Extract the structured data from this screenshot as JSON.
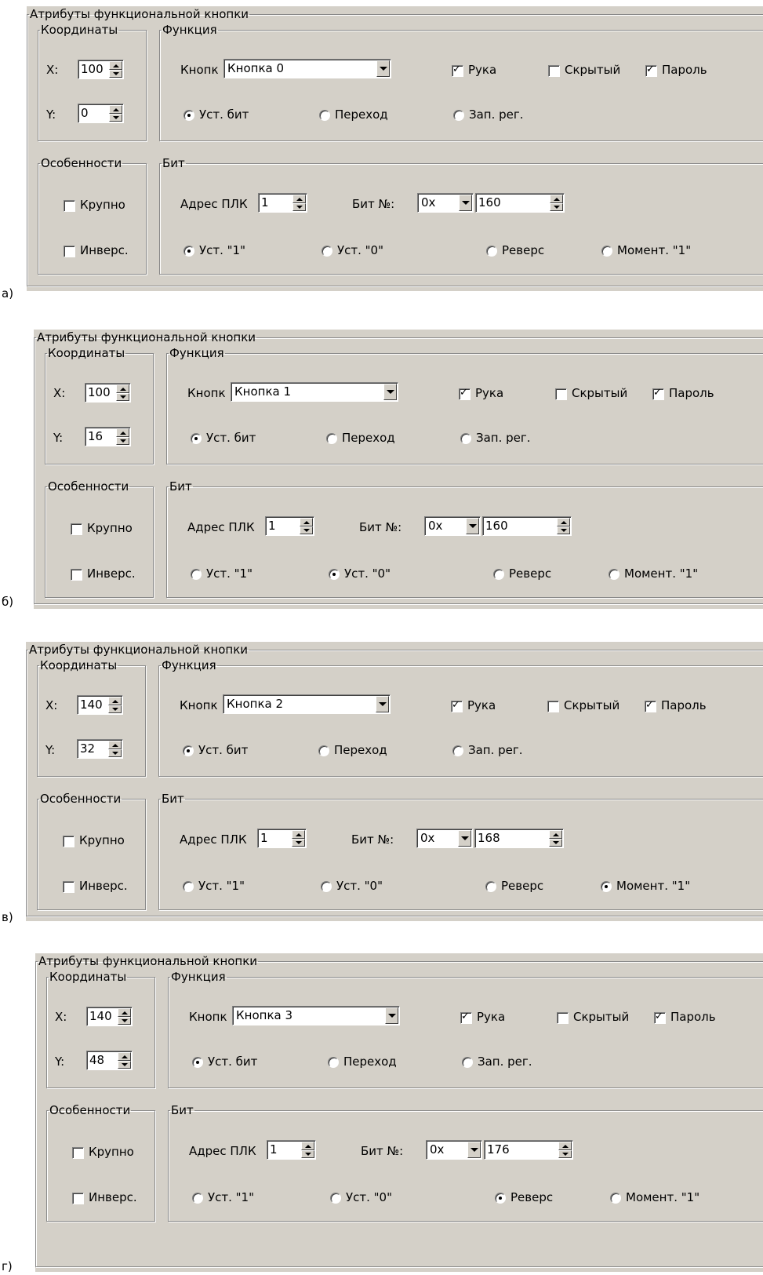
{
  "texts": {
    "panel_title": "Атрибуты функциональной кнопки",
    "coords_title": "Координаты",
    "function_title": "Функция",
    "features_title": "Особенности",
    "bit_title": "Бит",
    "x_label": "X:",
    "y_label": "Y:",
    "button_label": "Кнопк",
    "hand_label": "Рука",
    "hidden_label": "Скрытый",
    "password_label": "Пароль",
    "set_bit_label": "Уст. бит",
    "transition_label": "Переход",
    "write_reg_label": "Зап. рег.",
    "large_label": "Крупно",
    "invert_label": "Инверс.",
    "plc_addr_label": "Адрес ПЛК",
    "bit_num_label": "Бит №:",
    "set1_label": "Уст. \"1\"",
    "set0_label": "Уст. \"0\"",
    "reverse_label": "Реверс",
    "moment1_label": "Момент. \"1\""
  },
  "panels": [
    {
      "label": "а)",
      "x": "100",
      "y": "0",
      "button": "Кнопка 0",
      "hand": true,
      "hidden": false,
      "password": true,
      "function_mode": "set_bit",
      "large": false,
      "invert": false,
      "plc_addr": "1",
      "bit_prefix": "0x",
      "bit_num": "160",
      "bit_mode": "set1"
    },
    {
      "label": "б)",
      "x": "100",
      "y": "16",
      "button": "Кнопка 1",
      "hand": true,
      "hidden": false,
      "password": true,
      "function_mode": "set_bit",
      "large": false,
      "invert": false,
      "plc_addr": "1",
      "bit_prefix": "0x",
      "bit_num": "160",
      "bit_mode": "set0"
    },
    {
      "label": "в)",
      "x": "140",
      "y": "32",
      "button": "Кнопка 2",
      "hand": true,
      "hidden": false,
      "password": true,
      "function_mode": "set_bit",
      "large": false,
      "invert": false,
      "plc_addr": "1",
      "bit_prefix": "0x",
      "bit_num": "168",
      "bit_mode": "moment1"
    },
    {
      "label": "г)",
      "x": "140",
      "y": "48",
      "button": "Кнопка 3",
      "hand": true,
      "hidden": false,
      "password": true,
      "function_mode": "set_bit",
      "large": false,
      "invert": false,
      "plc_addr": "1",
      "bit_prefix": "0x",
      "bit_num": "176",
      "bit_mode": "reverse"
    }
  ]
}
